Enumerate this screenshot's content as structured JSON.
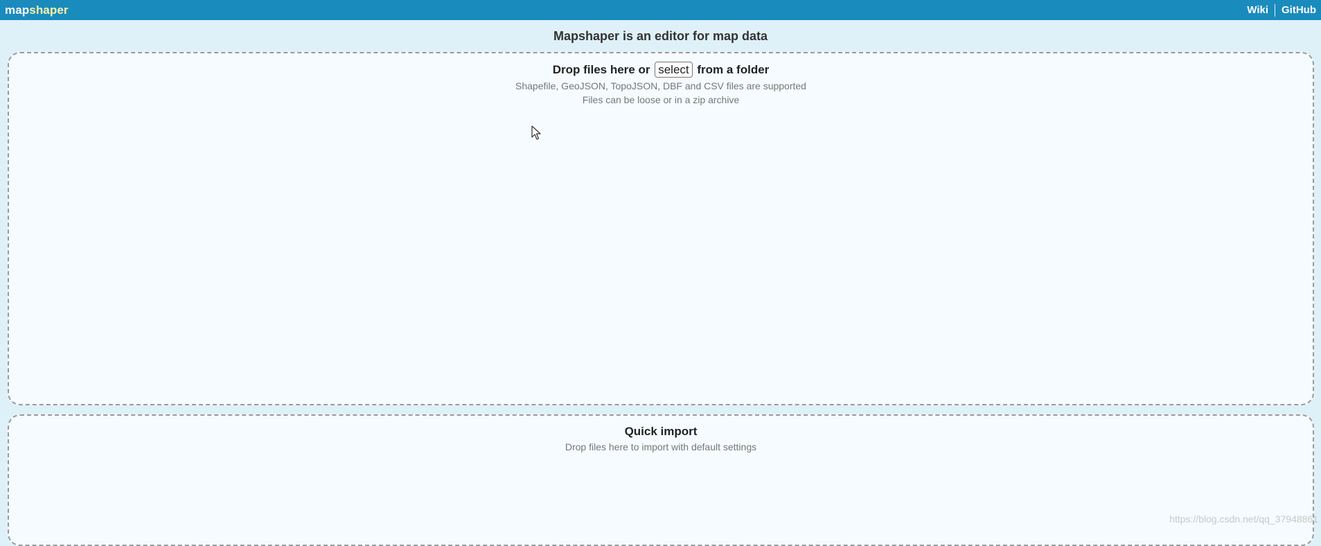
{
  "header": {
    "brand_part1": "map",
    "brand_part2": "shaper",
    "links": [
      "Wiki",
      "GitHub"
    ]
  },
  "headline": "Mapshaper is an editor for map data",
  "main_drop": {
    "title_before": "Drop files here or",
    "select_label": "select",
    "title_after": "from a folder",
    "line1": "Shapefile, GeoJSON, TopoJSON, DBF and CSV files are supported",
    "line2": "Files can be loose or in a zip archive"
  },
  "quick_import": {
    "title": "Quick import",
    "subtitle": "Drop files here to import with default settings"
  },
  "watermark": "https://blog.csdn.net/qq_37948861",
  "colors": {
    "topbar": "#1a8bbd",
    "page_bg": "#dff1f8",
    "dropzone_bg": "#f5fbfe",
    "brand_accent": "#fff3a8"
  },
  "icons": {
    "cursor": "mouse-pointer-icon"
  }
}
